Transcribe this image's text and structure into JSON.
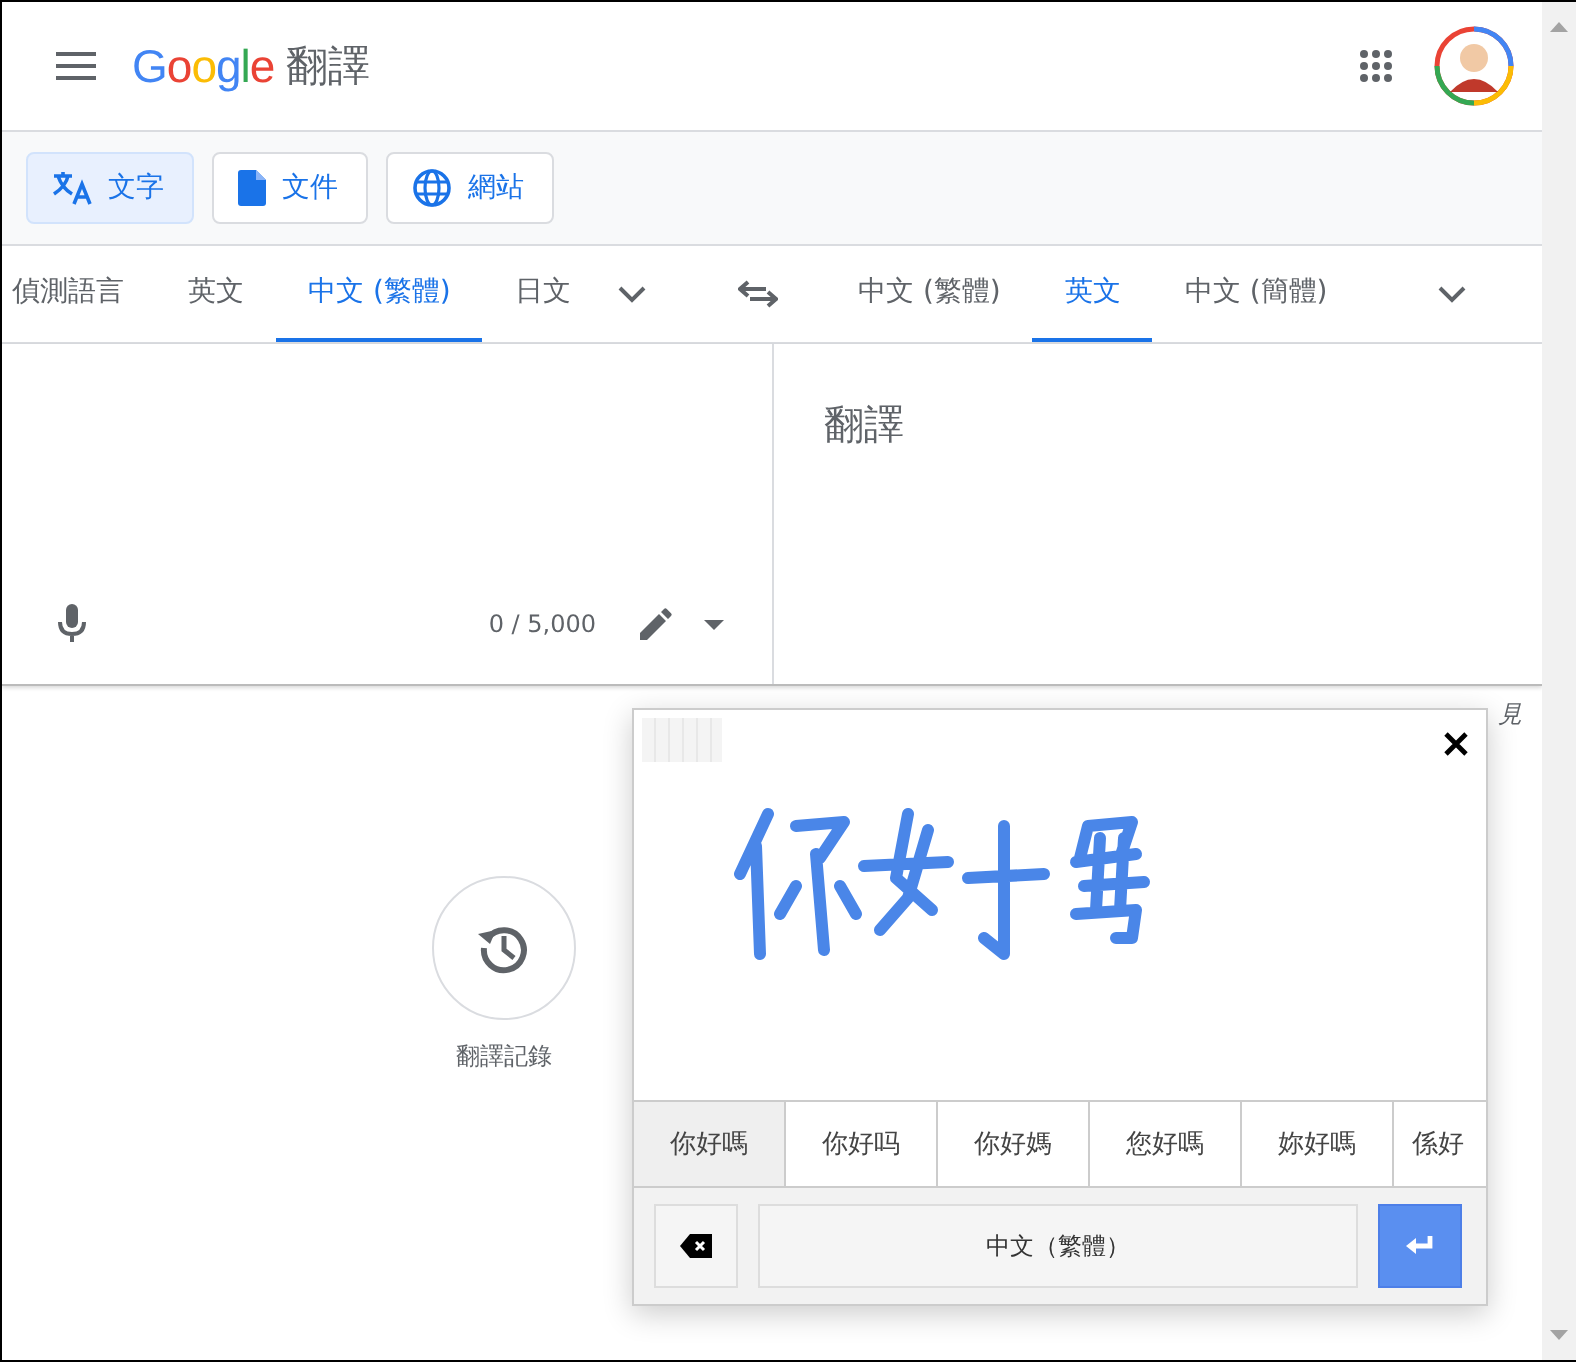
{
  "header": {
    "logo": "Google",
    "title": "翻譯"
  },
  "modes": [
    {
      "label": "文字",
      "kind": "text",
      "selected": true
    },
    {
      "label": "文件",
      "kind": "document",
      "selected": false
    },
    {
      "label": "網站",
      "kind": "website",
      "selected": false
    }
  ],
  "source_languages": [
    {
      "label": "偵測語言",
      "selected": false
    },
    {
      "label": "英文",
      "selected": false
    },
    {
      "label": "中文 (繁體)",
      "selected": true
    },
    {
      "label": "日文",
      "selected": false
    }
  ],
  "target_languages": [
    {
      "label": "中文 (繁體)",
      "selected": false
    },
    {
      "label": "英文",
      "selected": true
    },
    {
      "label": "中文 (簡體)",
      "selected": false
    }
  ],
  "source": {
    "char_count": "0 / 5,000"
  },
  "target": {
    "placeholder": "翻譯"
  },
  "history": {
    "label": "翻譯記錄"
  },
  "feedback": "見",
  "handwriting": {
    "candidates": [
      {
        "label": "你好嗎",
        "selected": true
      },
      {
        "label": "你好吗",
        "selected": false
      },
      {
        "label": "你好媽",
        "selected": false
      },
      {
        "label": "您好嗎",
        "selected": false
      },
      {
        "label": "妳好嗎",
        "selected": false
      },
      {
        "label": "係好",
        "selected": false
      }
    ],
    "language": "中文（繁體）"
  }
}
